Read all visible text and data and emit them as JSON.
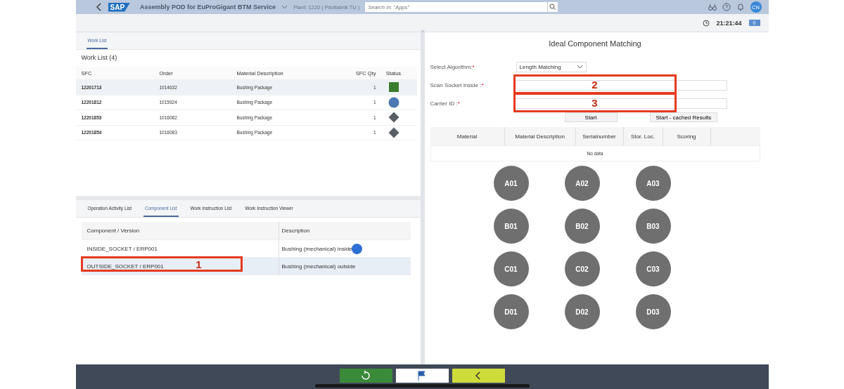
{
  "shell": {
    "logo": "SAP",
    "title": "Assembly POD for EuProGigant BTM Service",
    "plant": "Plant: 1220 ( Pilotfabrik TU )",
    "search": {
      "placeholder": "Search In: \"Apps\""
    },
    "avatar": "CN"
  },
  "subheader": {
    "time": "21:21:44",
    "notifications": "0"
  },
  "worklist_tabs": [
    {
      "label": "Work List",
      "selected": true
    }
  ],
  "worklist": {
    "title": "Work List (4)",
    "columns": [
      "SFC",
      "Order",
      "Material Description",
      "SFC Qty",
      "Status"
    ],
    "rows": [
      {
        "sfc": "12201713",
        "order": "1014632",
        "material": "Bushing Package",
        "qty": "1",
        "kind": "square",
        "color": "#3a7d2c",
        "selected": true
      },
      {
        "sfc": "12201812",
        "order": "1015924",
        "material": "Bushing Package",
        "qty": "1",
        "kind": "circle",
        "color": "#4a78b0",
        "selected": false
      },
      {
        "sfc": "12201853",
        "order": "1016082",
        "material": "Bushing Package",
        "qty": "1",
        "kind": "diamond",
        "color": "#5a5f66",
        "selected": false
      },
      {
        "sfc": "12201854",
        "order": "1016083",
        "material": "Bushing Package",
        "qty": "1",
        "kind": "diamond",
        "color": "#5a5f66",
        "selected": false
      }
    ]
  },
  "component_tabs": [
    {
      "label": "Operation Activity List",
      "selected": false
    },
    {
      "label": "Component List",
      "selected": true
    },
    {
      "label": "Work Instruction List",
      "selected": false
    },
    {
      "label": "Work Instruction Viewer",
      "selected": false
    }
  ],
  "components": {
    "columns": [
      "Component / Version",
      "Description"
    ],
    "rows": [
      {
        "component": "INSIDE_SOCKET / ERP001",
        "description": "Bushing (mechanical) inside",
        "selected": false,
        "dot": true,
        "annotation": ""
      },
      {
        "component": "OUTSIDE_SOCKET / ERP001",
        "description": "Bushing (mechanical) outside",
        "selected": true,
        "dot": false,
        "annotation": "1"
      }
    ]
  },
  "matching": {
    "title": "Ideal Component Matching",
    "algorithm": {
      "label": "Select Algorithm:",
      "required": "*",
      "value": "Length Matching"
    },
    "fields": [
      {
        "label": "Scan Socket Inside :",
        "required": "*",
        "annotation": "2"
      },
      {
        "label": "Carrier ID :",
        "required": "*",
        "annotation": "3"
      }
    ],
    "buttons": [
      "Start",
      "Start - cached Results"
    ],
    "table": {
      "columns": [
        "Material",
        "Material Description",
        "Serialnumber",
        "Stor. Loc.",
        "Scoring"
      ],
      "empty": "No data"
    },
    "slots": [
      [
        "A01",
        "A02",
        "A03"
      ],
      [
        "B01",
        "B02",
        "B03"
      ],
      [
        "C01",
        "C02",
        "C03"
      ],
      [
        "D01",
        "D02",
        "D03"
      ]
    ]
  },
  "footer_buttons": [
    {
      "kind": "refresh",
      "color": "#3a8a3a"
    },
    {
      "kind": "flag",
      "color": "#ffffff"
    },
    {
      "kind": "back",
      "color": "#cddc39"
    }
  ]
}
